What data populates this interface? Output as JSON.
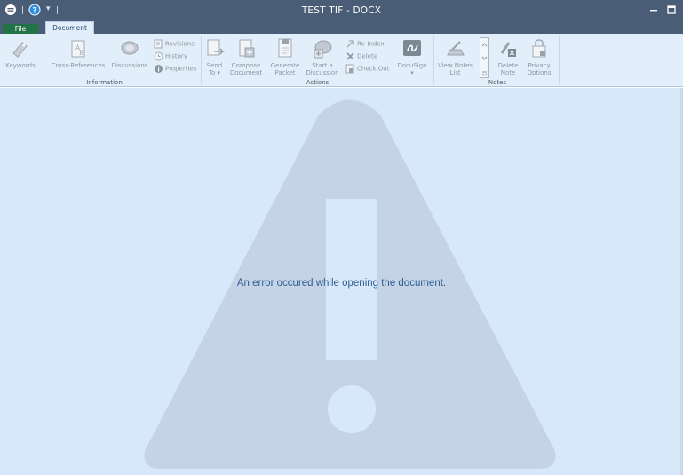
{
  "window": {
    "title": "TEST TIF - DOCX",
    "minimize_glyph": "–",
    "maximize_glyph": "□"
  },
  "quick_access": {
    "app_icon": "app-menu-icon",
    "help_icon": "help-icon",
    "dropdown_glyph": "▾"
  },
  "tabs": {
    "file": "File",
    "document": "Document"
  },
  "ribbon": {
    "groups": {
      "information": "Information",
      "actions": "Actions",
      "notes": "Notes"
    },
    "information": {
      "keywords": "Keywords",
      "cross_references": "Cross-References",
      "discussions": "Discussions",
      "revisions": "Revisions",
      "history": "History",
      "properties": "Properties"
    },
    "actions": {
      "send_to": [
        "Send",
        "To ▾"
      ],
      "compose_document": [
        "Compose",
        "Document"
      ],
      "generate_packet": [
        "Generate",
        "Packet"
      ],
      "start_discussion": [
        "Start a",
        "Discussion"
      ],
      "reindex": "Re-Index",
      "delete": "Delete",
      "check_out": "Check Out",
      "docusign": [
        "DocuSign",
        "▾"
      ]
    },
    "notes": {
      "view_notes_list": [
        "View Notes",
        "List"
      ],
      "delete_note": [
        "Delete",
        "Note"
      ],
      "privacy_options": [
        "Privacy",
        "Options"
      ]
    }
  },
  "document_view": {
    "error_message": "An error occured while opening the document.",
    "background_icon": "warning-triangle-icon"
  },
  "colors": {
    "titlebar": "#4a5d76",
    "ribbon": "#e2eef9",
    "file_tab": "#227447",
    "content_bg": "#d8e8fb",
    "warning_fill": "#c4d3e5",
    "error_text": "#2f5d91"
  }
}
